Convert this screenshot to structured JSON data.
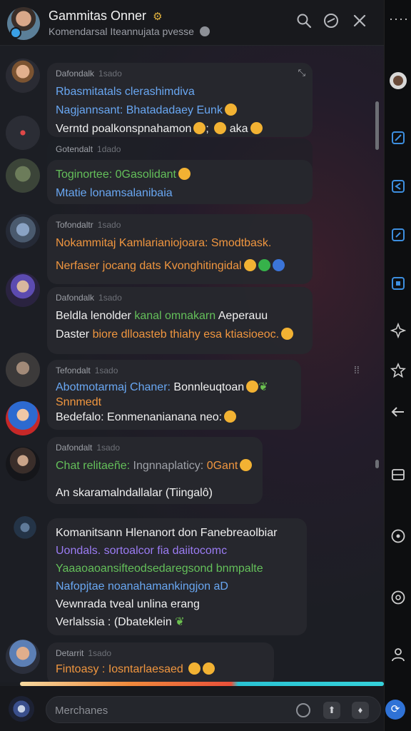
{
  "header": {
    "title": "Gammitas Onner",
    "subtitle": "Komendarsal Iteannujata pvesse"
  },
  "messages": [
    {
      "sender": "Dafondalk",
      "time": "1sado",
      "lines": [
        {
          "text": "Rbasmitatals clerashimdiva",
          "color": "blue"
        },
        {
          "text": "Nagjannsant: Bhatadadaey Eunk",
          "color": "blue",
          "emojis": [
            "y"
          ]
        },
        {
          "text": "Verntd poalkonspnahamon",
          "color": "white",
          "emojis": [
            "y"
          ],
          "after": "; ",
          "after2": "aka",
          "emojis2": [
            "y",
            "y"
          ]
        }
      ]
    },
    {
      "sender": "Gotendalt",
      "time": "1dado",
      "lines": [
        {
          "text": "Toginortee: 0Gasolidant",
          "color": "green",
          "emojis": [
            "y"
          ]
        },
        {
          "text": "Mtatie lonamsalanibaia",
          "color": "blue"
        }
      ]
    },
    {
      "sender": "Tofondaltr",
      "time": "1sado",
      "lines": [
        {
          "text": "Nokammitaj Kamlarianiojoara: Smodtbask.",
          "color": "orange"
        },
        {
          "text": "Nerfaser jocang dats Kvonghitingidal",
          "color": "orange",
          "emojis": [
            "y",
            "g",
            "b"
          ]
        }
      ]
    },
    {
      "sender": "Dafondalk",
      "time": "1sado",
      "lines": [
        {
          "text": "Beldla lenolder",
          "color": "white",
          "tail": "kanal omnakarn",
          "tailColor": "green",
          "tail2": "Aeperauu",
          "tail2Color": "white"
        },
        {
          "text": "Daster",
          "color": "white",
          "tail": "biore dlloasteb thiahy esa ktiasioeoc.",
          "tailColor": "orange",
          "emojis": [
            "y"
          ]
        }
      ]
    },
    {
      "sender": "Tefondalt",
      "time": "1sado",
      "lines": [
        {
          "text": "Abotmotarmaj Chaner:",
          "color": "blue",
          "tail": "Bonnleuqtoan",
          "tailColor": "white",
          "emojis": [
            "y"
          ],
          "leaf": true
        },
        {
          "text": "Snnmedt",
          "color": "orange"
        },
        {
          "text": "Bedefalo: Eonmenanianana neo:",
          "color": "white",
          "emojis": [
            "y"
          ]
        }
      ]
    },
    {
      "sender": "Dafondalt",
      "time": "1sado",
      "lines": [
        {
          "text": "Chat relitaeñe:",
          "color": "green",
          "tail": "Ingnnaplaticy:",
          "tailColor": "gray",
          "tail2": "0Gant",
          "tail2Color": "orange",
          "emojis": [
            "y"
          ]
        },
        {
          "text": "An skaramalndallalar (Tiingalô)",
          "color": "white"
        }
      ]
    },
    {
      "sender": "",
      "time": "",
      "lines": [
        {
          "text": "Komanitsann Hlenanort don Fanebreaolbiar",
          "color": "white"
        },
        {
          "text": "Uondals. sortoalcor fia daiitocomc",
          "color": "purple"
        },
        {
          "text": "Yaaaoaoansifteodsedaregsond bnmpalte",
          "color": "green"
        },
        {
          "text": "Nafopjtae noanahamankingjon aD",
          "color": "blue"
        },
        {
          "text": "Vewnrada tveal unlina erang",
          "color": "white"
        },
        {
          "text": "Verlalssia : (Dbateklein",
          "color": "white",
          "leaf": true
        }
      ]
    },
    {
      "sender": "Detarrit",
      "time": "1sado",
      "lines": [
        {
          "text": "Fintoasy :",
          "color": "orange",
          "tail": "Iosntarlaesaed",
          "tailColor": "orange",
          "emojis": [
            "y",
            "y"
          ]
        }
      ]
    }
  ],
  "composer": {
    "placeholder": "Merchanes"
  },
  "colors": {
    "accent": "#2f72d6",
    "background": "#1b1d22",
    "bubble": "#26282e"
  },
  "icons": [
    "search-icon",
    "emoji-icon",
    "close-icon",
    "more-icon",
    "send-icon"
  ]
}
